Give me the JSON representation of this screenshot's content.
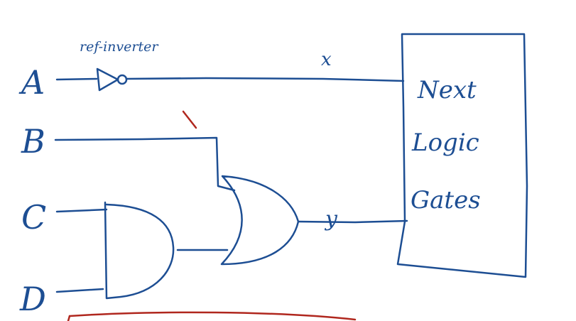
{
  "diagram": {
    "colors": {
      "ink": "#1d4e93",
      "red_ink": "#b0271e",
      "background": "#ffffff"
    },
    "inputs": [
      {
        "id": "a",
        "label": "A"
      },
      {
        "id": "b",
        "label": "B"
      },
      {
        "id": "c",
        "label": "C"
      },
      {
        "id": "d",
        "label": "D"
      }
    ],
    "inverter_label": "ref-inverter",
    "signals": {
      "x": "x",
      "y": "y"
    },
    "block": {
      "line1": "Next",
      "line2": "Logic",
      "line3": "Gates"
    },
    "gates": {
      "and_gate": "and-gate-symbol",
      "or_gate": "or-gate-symbol",
      "not_gate": "not-gate-symbol"
    }
  }
}
